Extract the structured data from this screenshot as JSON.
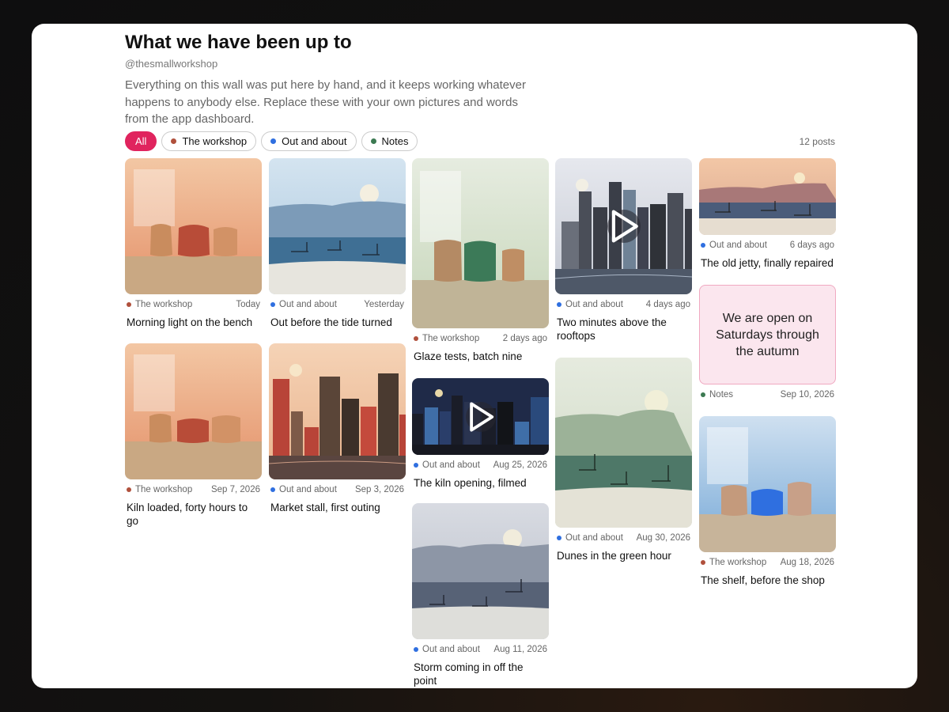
{
  "page": {
    "title": "What we have been up to",
    "handle": "@thesmallworkshop",
    "description": "Everything on this wall was put here by hand, and it keeps working whatever happens to anybody else. Replace these with your own pictures and words from the app dashboard.",
    "post_count": "12 posts"
  },
  "filters": [
    {
      "label": "All",
      "active": true
    },
    {
      "label": "The workshop",
      "color": "#b0503c"
    },
    {
      "label": "Out and about",
      "color": "#2f6fe0"
    },
    {
      "label": "Notes",
      "color": "#3c7a52"
    }
  ],
  "colors": {
    "accent": "#e0245e",
    "workshop": "#b0503c",
    "out": "#2f6fe0",
    "notes": "#3c7a52"
  },
  "posts": [
    {
      "title": "Morning light on the bench",
      "category": "The workshop",
      "date": "Today"
    },
    {
      "title": "Kiln loaded, forty hours to go",
      "category": "The workshop",
      "date": "Sep 7, 2026"
    },
    {
      "title": "Out before the tide turned",
      "category": "Out and about",
      "date": "Yesterday"
    },
    {
      "title": "Market stall, first outing",
      "category": "Out and about",
      "date": "Sep 3, 2026"
    },
    {
      "title": "Glaze tests, batch nine",
      "category": "The workshop",
      "date": "2 days ago"
    },
    {
      "title": "The kiln opening, filmed",
      "category": "Out and about",
      "date": "Aug 25, 2026",
      "video": true
    },
    {
      "title": "Storm coming in off the point",
      "category": "Out and about",
      "date": "Aug 11, 2026"
    },
    {
      "title": "Two minutes above the rooftops",
      "category": "Out and about",
      "date": "4 days ago",
      "video": true
    },
    {
      "title": "Dunes in the green hour",
      "category": "Out and about",
      "date": "Aug 30, 2026"
    },
    {
      "title": "The old jetty, finally repaired",
      "category": "Out and about",
      "date": "6 days ago"
    },
    {
      "note": "We are open on Saturdays through the autumn",
      "category": "Notes",
      "date": "Sep 10, 2026"
    },
    {
      "title": "The shelf, before the shop",
      "category": "The workshop",
      "date": "Aug 18, 2026"
    }
  ]
}
